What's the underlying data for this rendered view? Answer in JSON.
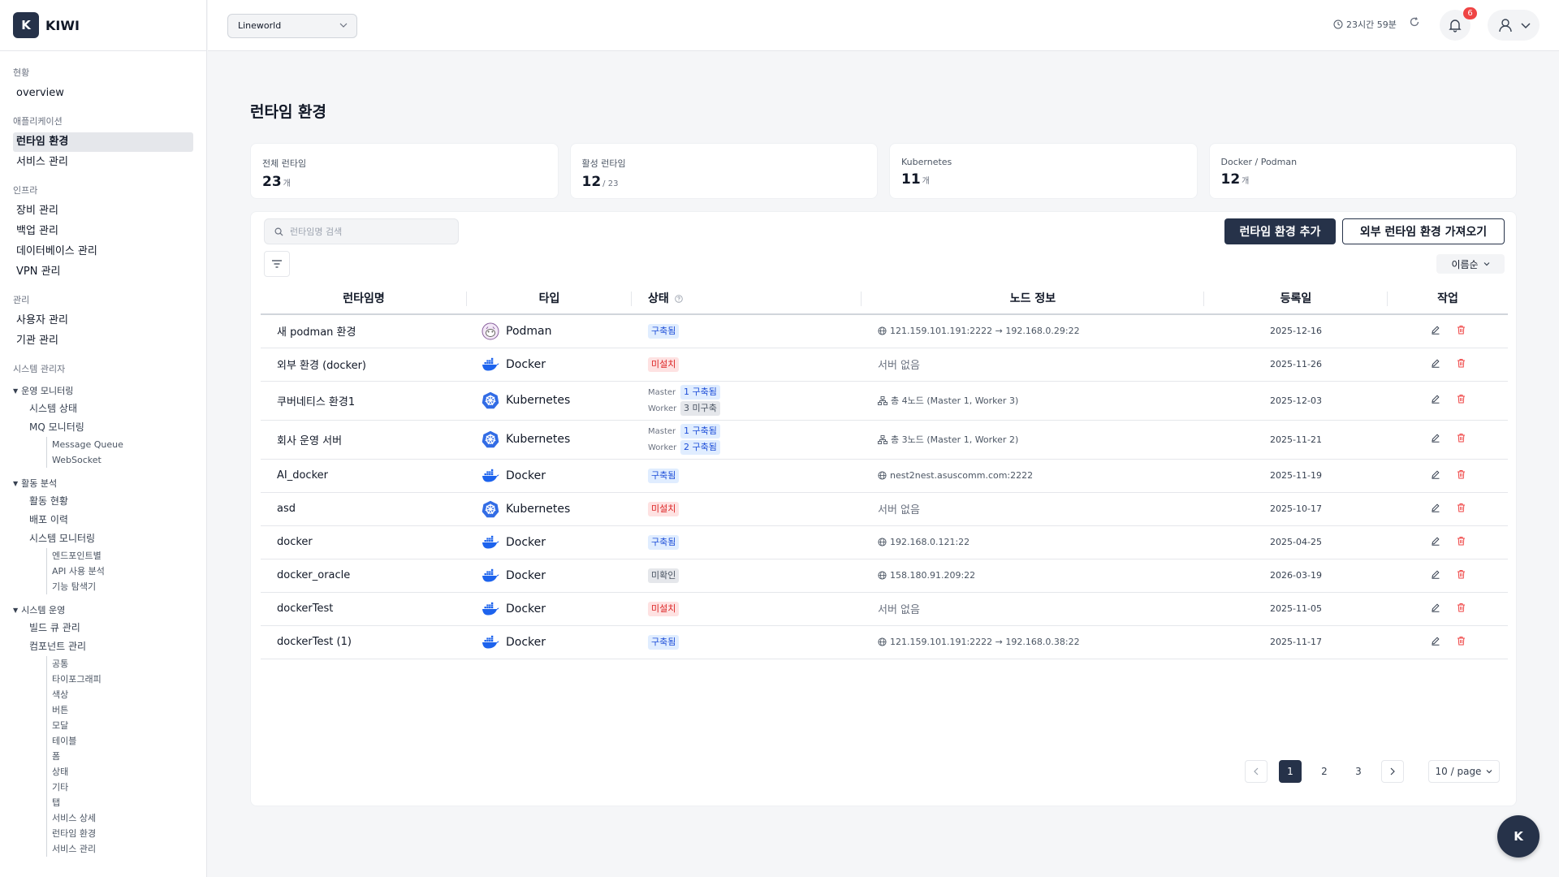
{
  "app": {
    "logo_letter": "K",
    "name": "KIWI"
  },
  "sidebar": {
    "sections": [
      {
        "title": "현황",
        "items": [
          {
            "label": "overview",
            "active": false
          }
        ]
      },
      {
        "title": "애플리케이션",
        "items": [
          {
            "label": "런타임 환경",
            "active": true
          },
          {
            "label": "서비스 관리",
            "active": false
          }
        ]
      },
      {
        "title": "인프라",
        "items": [
          {
            "label": "장비 관리"
          },
          {
            "label": "백업 관리"
          },
          {
            "label": "데이터베이스 관리"
          },
          {
            "label": "VPN 관리"
          }
        ]
      },
      {
        "title": "관리",
        "items": [
          {
            "label": "사용자 관리"
          },
          {
            "label": "기관 관리"
          }
        ]
      }
    ],
    "sysadmin": {
      "title": "시스템 관리자",
      "groups": [
        {
          "label": "운영 모니터링",
          "subs": [
            "시스템 상태",
            "MQ 모니터링"
          ],
          "subs2": [
            "Message Queue",
            "WebSocket"
          ]
        },
        {
          "label": "활동 분석",
          "subs": [
            "활동 현황",
            "배포 이력",
            "시스템 모니터링"
          ],
          "subs2": [
            "엔드포인트별",
            "API 사용 분석",
            "기능 탐색기"
          ]
        },
        {
          "label": "시스템 운영",
          "subs": [
            "빌드 큐 관리",
            "컴포넌트 관리"
          ],
          "subs2": [
            "공통",
            "타이포그래피",
            "색상",
            "버튼",
            "모달",
            "테이블",
            "폼",
            "상태",
            "기타",
            "탭",
            "서비스 상세",
            "런타임 환경",
            "서비스 관리"
          ]
        }
      ]
    }
  },
  "topbar": {
    "org_select": "Lineworld",
    "timer": "23시간 59분",
    "notification_count": "6"
  },
  "page": {
    "title": "런타임 환경"
  },
  "stats": [
    {
      "label": "전체 런타임",
      "value": "23",
      "unit": "개"
    },
    {
      "label": "활성 런타임",
      "value": "12",
      "unit": "/ 23"
    },
    {
      "label": "Kubernetes",
      "value": "11",
      "unit": "개"
    },
    {
      "label": "Docker / Podman",
      "value": "12",
      "unit": "개"
    }
  ],
  "toolbar": {
    "search_placeholder": "런타임명 검색",
    "add_button": "런타임 환경 추가",
    "import_button": "외부 런타임 환경 가져오기",
    "sort_label": "이름순"
  },
  "table": {
    "headers": [
      "런타임명",
      "타입",
      "상태",
      "노드 정보",
      "등록일",
      "작업"
    ],
    "rows": [
      {
        "name": "새 podman 환경",
        "type": "Podman",
        "status": "구축됨",
        "status_kind": "blue",
        "node": "121.159.101.191:2222 → 192.168.0.29:22",
        "node_kind": "ip",
        "date": "2025-12-16"
      },
      {
        "name": "외부 환경 (docker)",
        "type": "Docker",
        "status": "미설치",
        "status_kind": "red",
        "node": "서버 없음",
        "node_kind": "none",
        "date": "2025-11-26"
      },
      {
        "name": "쿠버네티스 환경1",
        "type": "Kubernetes",
        "k8s": {
          "master_label": "Master",
          "master_status": "1 구축됨",
          "worker_label": "Worker",
          "worker_status": "3 미구축",
          "worker_kind": "gray"
        },
        "node": "총 4노드 (Master 1, Worker 3)",
        "node_kind": "cluster",
        "date": "2025-12-03"
      },
      {
        "name": "회사 운영 서버",
        "type": "Kubernetes",
        "k8s": {
          "master_label": "Master",
          "master_status": "1 구축됨",
          "worker_label": "Worker",
          "worker_status": "2 구축됨",
          "worker_kind": "blue"
        },
        "node": "총 3노드 (Master 1, Worker 2)",
        "node_kind": "cluster",
        "date": "2025-11-21"
      },
      {
        "name": "AI_docker",
        "type": "Docker",
        "status": "구축됨",
        "status_kind": "blue",
        "node": "nest2nest.asuscomm.com:2222",
        "node_kind": "ip",
        "date": "2025-11-19"
      },
      {
        "name": "asd",
        "type": "Kubernetes",
        "status": "미설치",
        "status_kind": "red",
        "node": "서버 없음",
        "node_kind": "none",
        "date": "2025-10-17"
      },
      {
        "name": "docker",
        "type": "Docker",
        "status": "구축됨",
        "status_kind": "blue",
        "node": "192.168.0.121:22",
        "node_kind": "ip",
        "date": "2025-04-25"
      },
      {
        "name": "docker_oracle",
        "type": "Docker",
        "status": "미확인",
        "status_kind": "gray",
        "node": "158.180.91.209:22",
        "node_kind": "ip",
        "date": "2026-03-19"
      },
      {
        "name": "dockerTest",
        "type": "Docker",
        "status": "미설치",
        "status_kind": "red",
        "node": "서버 없음",
        "node_kind": "none",
        "date": "2025-11-05"
      },
      {
        "name": "dockerTest (1)",
        "type": "Docker",
        "status": "구축됨",
        "status_kind": "blue",
        "node": "121.159.101.191:2222 → 192.168.0.38:22",
        "node_kind": "ip",
        "date": "2025-11-17"
      }
    ]
  },
  "pagination": {
    "pages": [
      "1",
      "2",
      "3"
    ],
    "current": "1",
    "per_page": "10 / page"
  },
  "fab": {
    "label": "K"
  },
  "colors": {
    "primary": "#263249",
    "tag_blue": "#1d4ed8",
    "tag_red": "#dc2626",
    "docker": "#1d63ed",
    "kubernetes": "#326ce5"
  }
}
